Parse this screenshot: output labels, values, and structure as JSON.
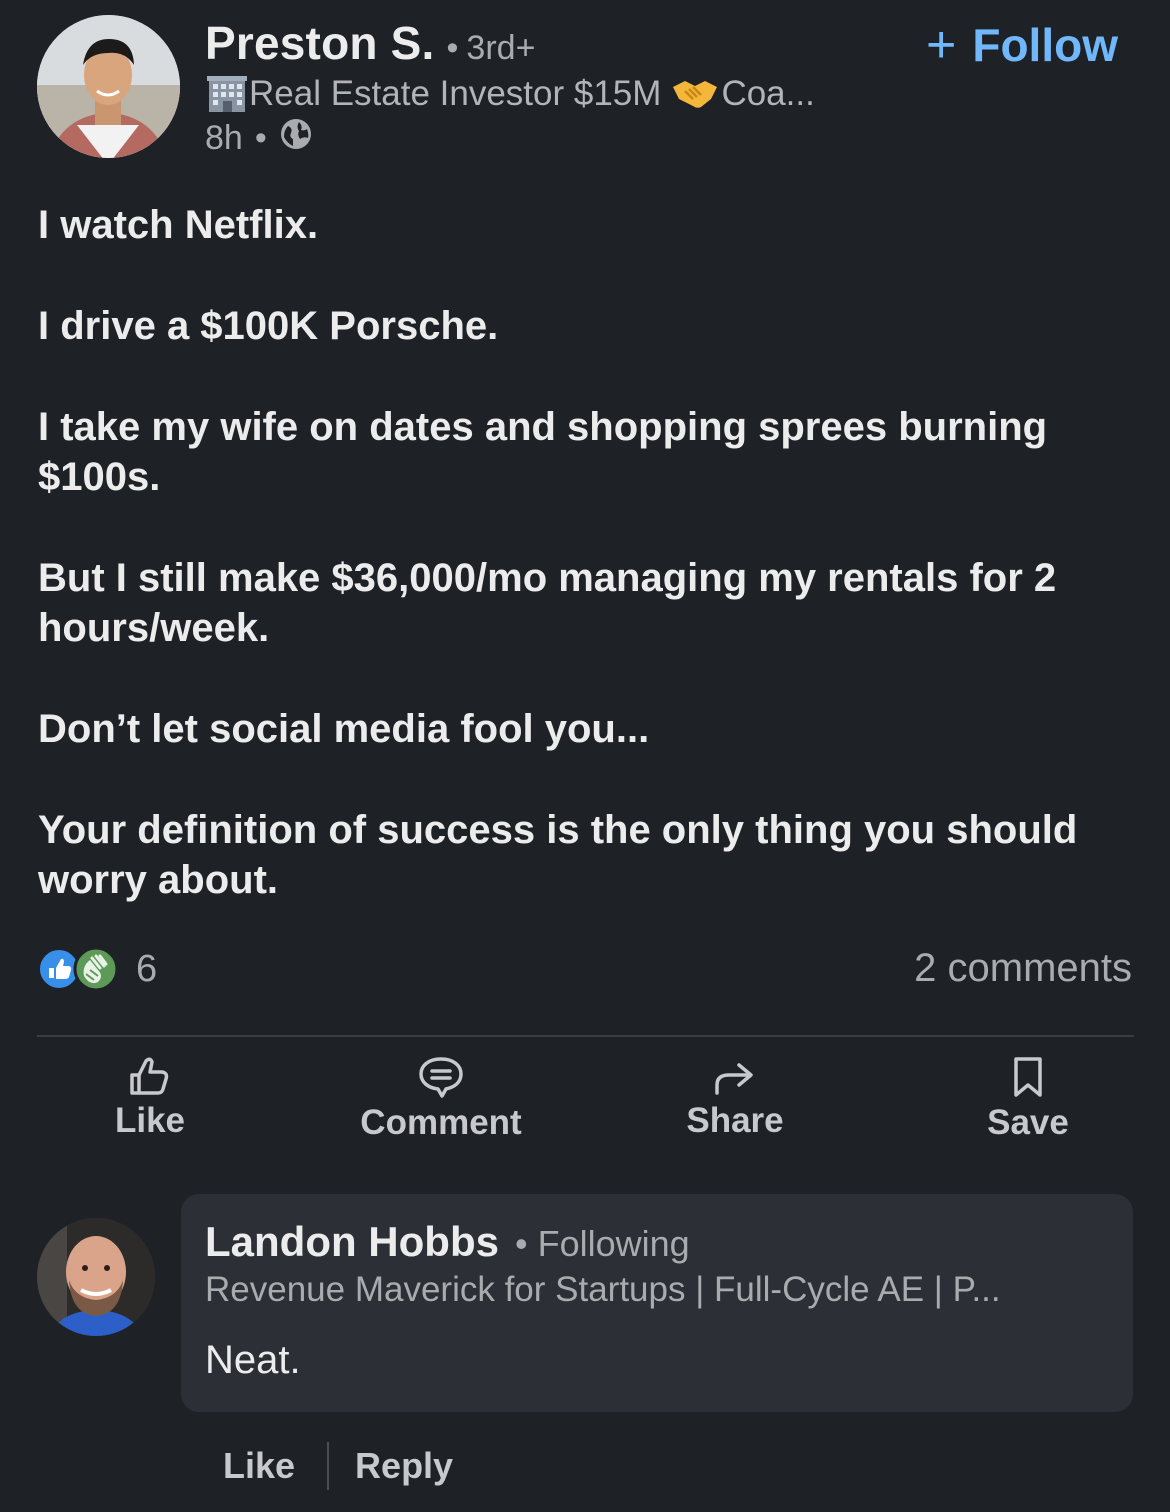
{
  "post": {
    "author": {
      "name": "Preston S.",
      "degree": "3rd+",
      "headline_prefix_icon": "office-building-icon",
      "headline_part1": "Real Estate Investor $15M",
      "headline_mid_icon": "handshake-icon",
      "headline_part2": "Coa...",
      "time": "8h",
      "visibility_icon": "globe-icon"
    },
    "follow_label": "Follow",
    "body": [
      "I watch Netflix.",
      "I drive a $100K Porsche.",
      "I take my wife on dates and shopping sprees burning $100s.",
      "But I still make $36,000/mo managing my rentals for 2 hours/week.",
      "Don’t let social media fool you...",
      "Your definition of success is the only thing you should worry about."
    ],
    "reactions": {
      "icons": [
        "like-reaction-icon",
        "celebrate-reaction-icon"
      ],
      "count": "6"
    },
    "comments_count": "2 comments",
    "actions": {
      "like": "Like",
      "comment": "Comment",
      "share": "Share",
      "save": "Save"
    }
  },
  "comment": {
    "name": "Landon Hobbs",
    "relation": "Following",
    "headline": "Revenue Maverick for Startups | Full-Cycle AE | P...",
    "text": "Neat.",
    "like_label": "Like",
    "reply_label": "Reply"
  },
  "colors": {
    "background": "#1e2126",
    "accent": "#71b7fb",
    "bubble": "#2c3036"
  }
}
